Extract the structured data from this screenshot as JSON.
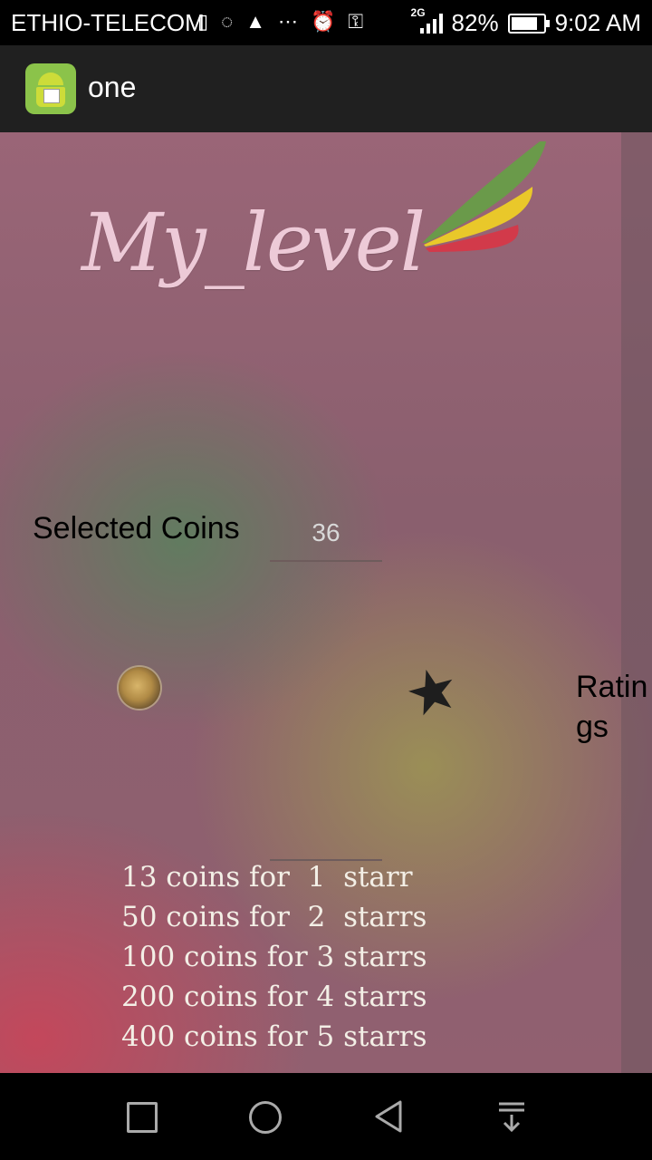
{
  "status_bar": {
    "carrier": "ETHIO-TELECOM",
    "network": "2G",
    "battery_percent": "82%",
    "battery_level": 0.82,
    "time": "9:02 AM",
    "icons": [
      "sim-icon",
      "chat-icon",
      "battery-alert-icon",
      "more-icon",
      "alarm-icon",
      "key-icon",
      "signal-icon"
    ]
  },
  "action_bar": {
    "title": "one",
    "icon": "android-app-icon"
  },
  "main": {
    "logo_text": "My_level",
    "selected_coins_label": "Selected Coins",
    "selected_coins_value": "36",
    "ratings_label": "Ratin\ngs",
    "coin_rules": [
      "13 coins for  1  starr",
      "50 coins for  2  starrs",
      "100 coins for 3 starrs",
      "200 coins for 4 starrs",
      "400 coins for 5 starrs"
    ]
  },
  "colors": {
    "wing_green": "#6a9a4a",
    "wing_yellow": "#e9c82a",
    "wing_red": "#d23a4a"
  },
  "nav_bar": {
    "buttons": [
      "recent-apps",
      "home",
      "back",
      "notifications"
    ]
  }
}
